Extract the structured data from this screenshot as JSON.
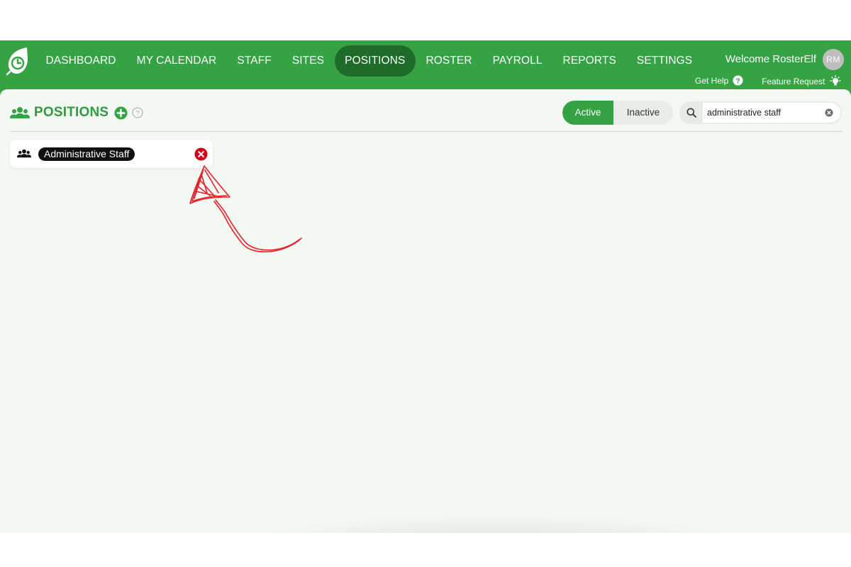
{
  "nav": {
    "items": [
      {
        "label": "DASHBOARD",
        "active": false
      },
      {
        "label": "MY CALENDAR",
        "active": false
      },
      {
        "label": "STAFF",
        "active": false
      },
      {
        "label": "SITES",
        "active": false
      },
      {
        "label": "POSITIONS",
        "active": true
      },
      {
        "label": "ROSTER",
        "active": false
      },
      {
        "label": "PAYROLL",
        "active": false
      },
      {
        "label": "REPORTS",
        "active": false
      },
      {
        "label": "SETTINGS",
        "active": false
      }
    ]
  },
  "user": {
    "welcome": "Welcome RosterElf",
    "initials": "RM"
  },
  "utilities": {
    "help": "Get Help",
    "feature_request": "Feature Request"
  },
  "page": {
    "title": "POSITIONS"
  },
  "filter": {
    "active": "Active",
    "inactive": "Inactive",
    "selected": "Active"
  },
  "search": {
    "value": "administrative staff"
  },
  "positions": [
    {
      "name": "Administrative Staff"
    }
  ],
  "colors": {
    "brand_green": "#35a244",
    "nav_active": "#1f6b2a",
    "remove_red": "#d0021b",
    "annotation_red": "#e8202a"
  }
}
